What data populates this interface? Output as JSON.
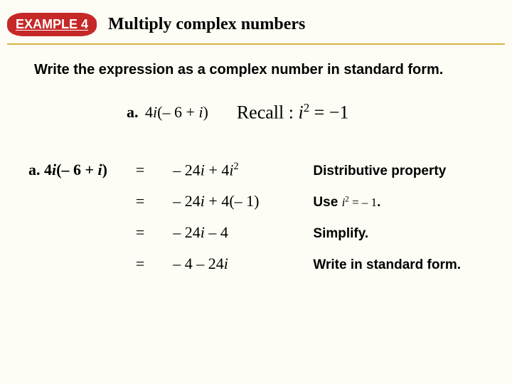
{
  "header": {
    "badge": "EXAMPLE 4",
    "title": "Multiply complex numbers"
  },
  "instruction": "Write the expression as a complex number in standard form.",
  "problem": {
    "label": "a.",
    "expr_pre": " 4",
    "expr_var1": "i",
    "expr_mid": "(– 6 + ",
    "expr_var2": "i",
    "expr_post": ")"
  },
  "recall": {
    "text_pre": "Recall :   ",
    "var": "i",
    "sup": "2",
    "text_post": " = −1"
  },
  "work": {
    "lhs_label": "a.",
    "lhs_pre": "  4",
    "lhs_v1": "i",
    "lhs_mid": "(– 6 + ",
    "lhs_v2": "i",
    "lhs_post": ")",
    "rows": [
      {
        "eq": "=",
        "r_pre": " – 24",
        "r_v1": "i",
        "r_mid": " + 4",
        "r_v2": "i",
        "r_sup": "2",
        "r_post": "",
        "reason": "Distributive property"
      },
      {
        "eq": "=",
        "r_pre": " – 24",
        "r_v1": "i",
        "r_mid": " + 4(– 1)",
        "r_v2": "",
        "r_sup": "",
        "r_post": "",
        "reason_pre": "Use ",
        "reason_math_v": "i",
        "reason_math_sup": "2",
        "reason_math_rest": " = – 1",
        "reason_post": "."
      },
      {
        "eq": "=",
        "r_pre": " – 24",
        "r_v1": "i",
        "r_mid": " – 4",
        "r_v2": "",
        "r_sup": "",
        "r_post": "",
        "reason": "Simplify."
      },
      {
        "eq": "=",
        "r_pre": " – 4 – 24",
        "r_v1": "i",
        "r_mid": "",
        "r_v2": "",
        "r_sup": "",
        "r_post": "",
        "reason": "Write in standard form."
      }
    ]
  }
}
